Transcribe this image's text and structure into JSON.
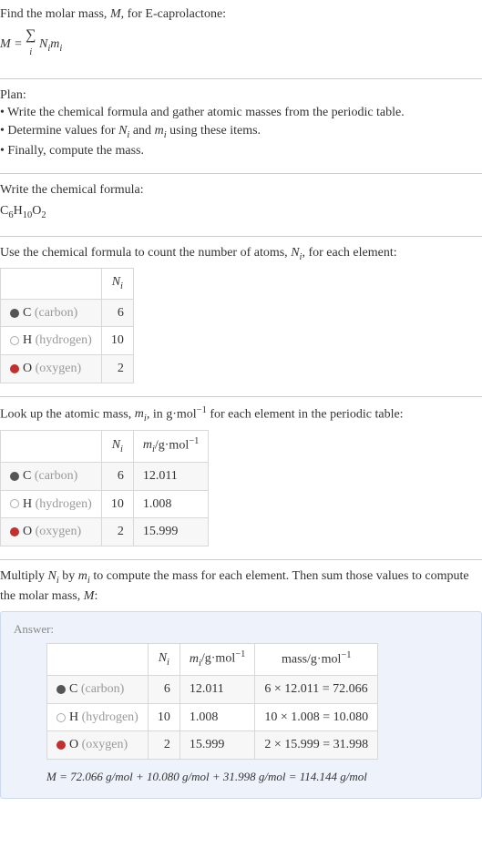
{
  "intro": {
    "title": "Find the molar mass, M, for E-caprolactone:",
    "formula_text": "M = "
  },
  "plan": {
    "heading": "Plan:",
    "b1_pre": "• Write the chemical formula and gather atomic masses from the periodic table.",
    "b2": "• Determine values for ",
    "b2_and": " and ",
    "b2_post": " using these items.",
    "b3": "• Finally, compute the mass."
  },
  "formula_section": {
    "heading": "Write the chemical formula:",
    "c": "C",
    "c_n": "6",
    "h": "H",
    "h_n": "10",
    "o": "O",
    "o_n": "2"
  },
  "count_section": {
    "heading_1": "Use the chemical formula to count the number of atoms, ",
    "heading_2": ", for each element:",
    "col_ni": "N",
    "col_ni_sub": "i",
    "rows": {
      "c_label": "C",
      "c_paren": "(carbon)",
      "c_n": "6",
      "h_label": "H",
      "h_paren": "(hydrogen)",
      "h_n": "10",
      "o_label": "O",
      "o_paren": "(oxygen)",
      "o_n": "2"
    }
  },
  "mass_section": {
    "heading_1": "Look up the atomic mass, ",
    "heading_2": ", in g·mol",
    "heading_3": " for each element in the periodic table:",
    "minus1": "−1",
    "col_mi_1": "m",
    "col_mi_sub": "i",
    "col_mi_unit": "/g·mol",
    "rows": {
      "c_m": "12.011",
      "h_m": "1.008",
      "o_m": "15.999"
    }
  },
  "multiply_section": {
    "heading_1": "Multiply ",
    "heading_2": " by ",
    "heading_3": " to compute the mass for each element. Then sum those values to compute the molar mass, ",
    "heading_4": ":"
  },
  "answer": {
    "label": "Answer:",
    "mass_col": "mass/g·mol",
    "c_calc": "6 × 12.011 = 72.066",
    "h_calc": "10 × 1.008 = 10.080",
    "o_calc": "2 × 15.999 = 31.998",
    "final": "M = 72.066 g/mol + 10.080 g/mol + 31.998 g/mol = 114.144 g/mol"
  },
  "sym": {
    "N": "N",
    "m": "m",
    "i": "i",
    "M": "M",
    "sum": "∑"
  }
}
